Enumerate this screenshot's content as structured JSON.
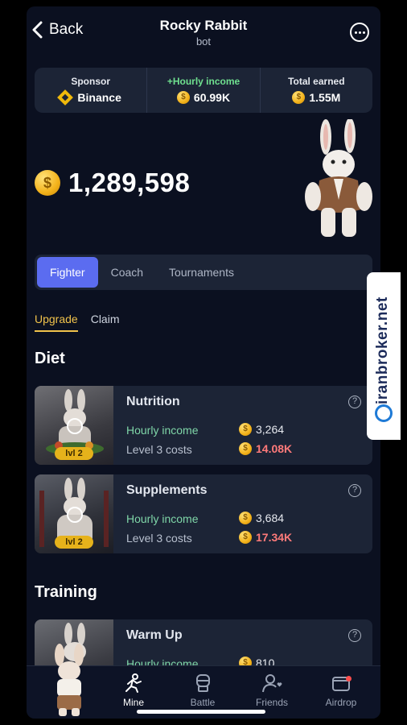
{
  "header": {
    "back_label": "Back",
    "title": "Rocky Rabbit",
    "subtitle": "bot"
  },
  "stats": [
    {
      "label": "Sponsor",
      "value": "Binance",
      "icon": "binance-logo"
    },
    {
      "label": "+Hourly income",
      "value": "60.99K",
      "icon": "coin-icon"
    },
    {
      "label": "Total earned",
      "value": "1.55M",
      "icon": "coin-icon"
    }
  ],
  "balance": "1,289,598",
  "tabs": [
    "Fighter",
    "Coach",
    "Tournaments"
  ],
  "subtabs": [
    "Upgrade",
    "Claim"
  ],
  "sections": {
    "diet": "Diet",
    "training": "Training"
  },
  "cards": [
    {
      "name": "Nutrition",
      "hourly_label": "Hourly income",
      "hourly_value": "3,264",
      "cost_label": "Level 3 costs",
      "cost_value": "14.08K",
      "level": "lvl 2"
    },
    {
      "name": "Supplements",
      "hourly_label": "Hourly income",
      "hourly_value": "3,684",
      "cost_label": "Level 3 costs",
      "cost_value": "17.34K",
      "level": "lvl 2"
    },
    {
      "name": "Warm Up",
      "hourly_label": "Hourly income",
      "hourly_value": "810"
    }
  ],
  "help_symbol": "?",
  "nav": [
    "Mine",
    "Battle",
    "Friends",
    "Airdrop"
  ],
  "watermark": "iranbroker.net",
  "colors": {
    "accent": "#5b6cf0",
    "gold": "#f0c24b",
    "cost_red": "#ff7a7a",
    "income_green": "#7fd6a8",
    "background": "#0b1020"
  }
}
